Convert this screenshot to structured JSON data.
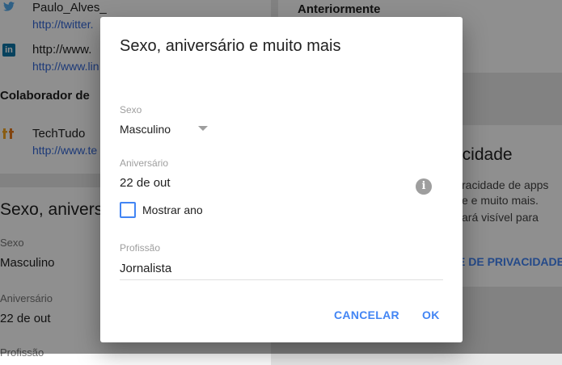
{
  "background": {
    "twitter_handle": "Paulo_Alves_",
    "twitter_url": "http://twitter.",
    "linkedin_handle": "http://www.",
    "linkedin_url": "http://www.lin",
    "contributor_heading": "Colaborador de",
    "contributor_name": "TechTudo",
    "contributor_url": "http://www.te",
    "section_title": "Sexo, aniversá",
    "sex_label": "Sexo",
    "sex_value": "Masculino",
    "birthday_label": "Aniversário",
    "birthday_value": "22 de out",
    "profession_label": "Profissão",
    "right_heading": "Anteriormente",
    "privacy_title": "acidade",
    "privacy_line1": "racidade de apps",
    "privacy_line2": "e e muito mais.",
    "privacy_line3": "ará visível para",
    "privacy_link": "E DE PRIVACIDADE"
  },
  "dialog": {
    "title": "Sexo, aniversário e muito mais",
    "sex_label": "Sexo",
    "sex_value": "Masculino",
    "birthday_label": "Aniversário",
    "birthday_value": "22 de out",
    "show_year_label": "Mostrar ano",
    "show_year_checked": false,
    "profession_label": "Profissão",
    "profession_value": "Jornalista",
    "cancel_label": "CANCELAR",
    "ok_label": "OK"
  },
  "colors": {
    "accent": "#4285f4",
    "link": "#3367d6",
    "overlay": "rgba(0,0,0,0.44)"
  }
}
